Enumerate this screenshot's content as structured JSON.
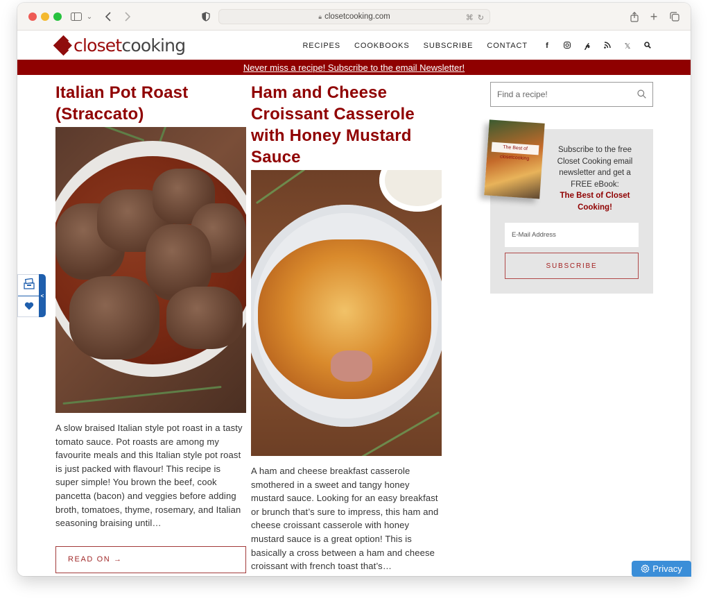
{
  "browser": {
    "url": "closetcooking.com",
    "buttons": {
      "sidebar_toggle": "sidebar-icon",
      "back": "chevron-left-icon",
      "forward": "chevron-right-icon",
      "privacy_shield": "shield-icon",
      "translate": "translate-icon",
      "reload": "reload-icon",
      "share": "share-icon",
      "new_tab": "plus-icon",
      "tabs_overview": "tabs-icon"
    }
  },
  "site": {
    "logo": {
      "part1": "closet",
      "part2": "cooking"
    },
    "nav": [
      "RECIPES",
      "COOKBOOKS",
      "SUBSCRIBE",
      "CONTACT"
    ],
    "social": [
      "facebook-icon",
      "instagram-icon",
      "pinterest-icon",
      "rss-icon",
      "x-icon",
      "search-icon"
    ],
    "banner_text": "Never miss a recipe! Subscribe to the email Newsletter!",
    "brand_color": "#8f0000"
  },
  "posts": [
    {
      "title": "Italian Pot Roast (Straccato)",
      "image_alt": "Italian pot roast in tomato sauce in a white bowl",
      "excerpt": "A slow braised Italian style pot roast in a tasty tomato sauce. Pot roasts are among my favourite meals and this Italian style pot roast is just packed with flavour! This recipe is super simple! You brown the beef, cook pancetta (bacon) and veggies before adding broth, tomatoes, thyme, rosemary, and Italian seasoning braising until…",
      "read_more": "READ ON →"
    },
    {
      "title": "Ham and Cheese Croissant Casserole with Honey Mustard Sauce",
      "image_alt": "Ham and cheese croissant casserole on a white plate",
      "excerpt": "A ham and cheese breakfast casserole smothered in a sweet and tangy honey mustard sauce. Looking for an easy breakfast or brunch that’s sure to impress, this ham and cheese croissant casserole with honey mustard sauce is a great option! This is basically a cross between a ham and cheese croissant with french toast that’s…"
    }
  ],
  "sidebar": {
    "search_placeholder": "Find a recipe!",
    "newsletter": {
      "ebook_label": "The Best of closetcooking",
      "text": "Subscribe to the free Closet Cooking email newsletter and get a FREE eBook:",
      "highlight": "The Best of Closet Cooking!",
      "email_placeholder": "E-Mail Address",
      "button": "SUBSCRIBE"
    }
  },
  "side_widget": {
    "icons": [
      "recipe-box-icon",
      "heart-icon"
    ],
    "toggle": "<"
  },
  "privacy_button": "Privacy"
}
